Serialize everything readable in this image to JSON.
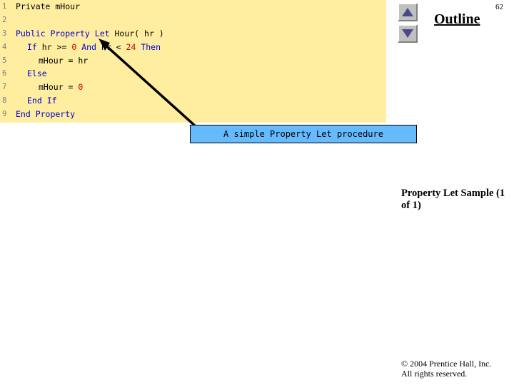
{
  "page_number": "62",
  "outline": {
    "title": "Outline",
    "up_label": "▲",
    "down_label": "▼"
  },
  "code": {
    "lines": [
      {
        "n": "1",
        "indent": 0,
        "tokens": [
          {
            "t": "Private mHour",
            "c": "pl"
          }
        ]
      },
      {
        "n": "2",
        "indent": 0,
        "tokens": []
      },
      {
        "n": "3",
        "indent": 0,
        "tokens": [
          {
            "t": "Public Property Let",
            "c": "kw"
          },
          {
            "t": " Hour( hr )",
            "c": "pl"
          }
        ]
      },
      {
        "n": "4",
        "indent": 1,
        "tokens": [
          {
            "t": "If",
            "c": "kw"
          },
          {
            "t": " hr >= ",
            "c": "pl"
          },
          {
            "t": "0",
            "c": "num"
          },
          {
            "t": " And",
            "c": "kw"
          },
          {
            "t": " hr < ",
            "c": "pl"
          },
          {
            "t": "24",
            "c": "num"
          },
          {
            "t": " Then",
            "c": "kw"
          }
        ]
      },
      {
        "n": "5",
        "indent": 2,
        "tokens": [
          {
            "t": "mHour = hr",
            "c": "pl"
          }
        ]
      },
      {
        "n": "6",
        "indent": 1,
        "tokens": [
          {
            "t": "Else",
            "c": "kw"
          }
        ]
      },
      {
        "n": "7",
        "indent": 2,
        "tokens": [
          {
            "t": "mHour = ",
            "c": "pl"
          },
          {
            "t": "0",
            "c": "num"
          }
        ]
      },
      {
        "n": "8",
        "indent": 1,
        "tokens": [
          {
            "t": "End If",
            "c": "kw"
          }
        ]
      },
      {
        "n": "9",
        "indent": 0,
        "tokens": [
          {
            "t": "End Property",
            "c": "kw"
          }
        ]
      }
    ]
  },
  "callout": {
    "text": "A simple Property Let procedure"
  },
  "slide_caption": "Property Let Sample (1 of 1)",
  "footer": {
    "line1": "© 2004 Prentice Hall, Inc.",
    "line2": "All rights reserved."
  },
  "colors": {
    "code_background": "#ffeda0",
    "callout_background": "#66bbff",
    "keyword": "#0000cc",
    "number": "#cc0000",
    "line_number": "#808080"
  }
}
